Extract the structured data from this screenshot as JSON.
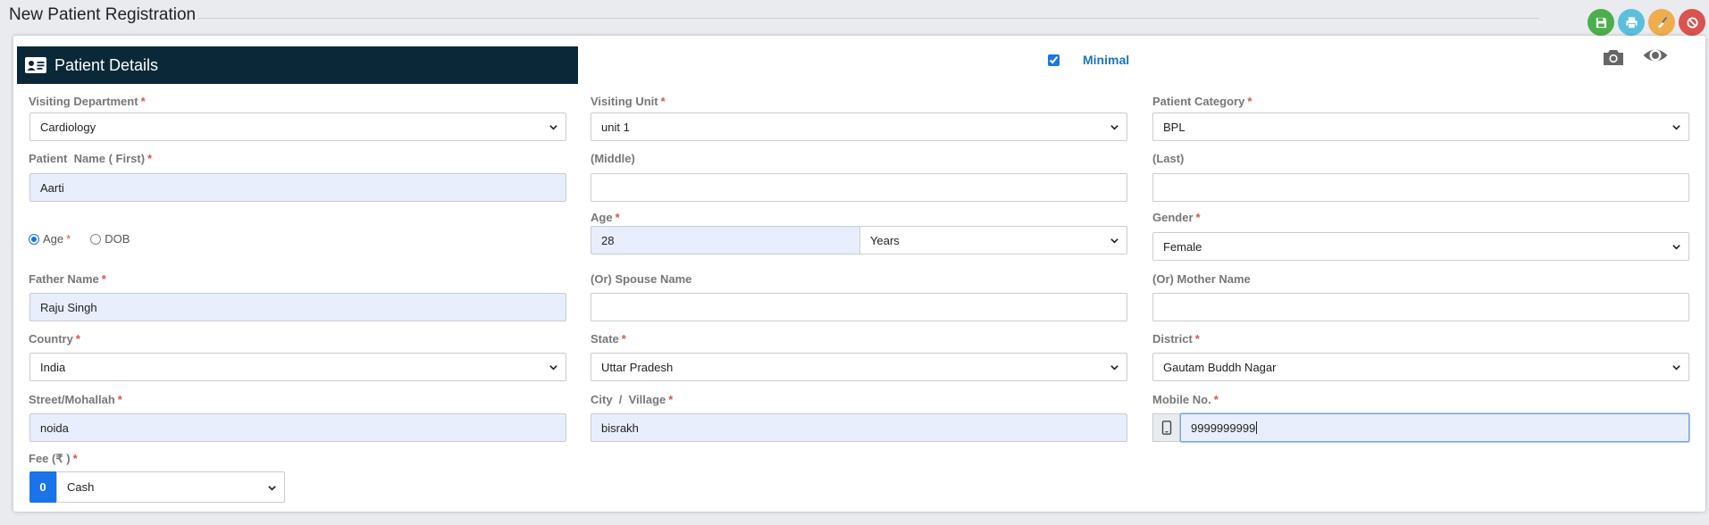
{
  "page": {
    "title": "New Patient Registration"
  },
  "toolbar": {
    "buttons": [
      {
        "name": "save",
        "icon": "save-icon",
        "color": "#4cae4c"
      },
      {
        "name": "print",
        "icon": "print-icon",
        "color": "#5bc0de"
      },
      {
        "name": "clear",
        "icon": "broom-icon",
        "color": "#f0ad4e"
      },
      {
        "name": "cancel",
        "icon": "ban-icon",
        "color": "#d9534f"
      }
    ]
  },
  "panel": {
    "title": "Patient Details",
    "minimal_label": "Minimal",
    "minimal_checked": true
  },
  "form": {
    "visiting_department": {
      "label": "Visiting Department",
      "value": "Cardiology"
    },
    "visiting_unit": {
      "label": "Visiting Unit",
      "value": "unit 1"
    },
    "patient_category": {
      "label": "Patient Category",
      "value": "BPL"
    },
    "first_name": {
      "label": "Patient  Name ( First)",
      "value": "Aarti"
    },
    "middle_name": {
      "label": "(Middle)",
      "value": ""
    },
    "last_name": {
      "label": "(Last)",
      "value": ""
    },
    "age_mode": {
      "age_label": "Age",
      "dob_label": "DOB",
      "selected": "age"
    },
    "age": {
      "label": "Age",
      "value": "28",
      "unit": "Years"
    },
    "gender": {
      "label": "Gender",
      "value": "Female"
    },
    "father_name": {
      "label": "Father Name",
      "value": "Raju Singh"
    },
    "spouse_name": {
      "label": "(Or) Spouse Name",
      "value": ""
    },
    "mother_name": {
      "label": "(Or) Mother Name",
      "value": ""
    },
    "country": {
      "label": "Country",
      "value": "India"
    },
    "state": {
      "label": "State",
      "value": "Uttar Pradesh"
    },
    "district": {
      "label": "District",
      "value": "Gautam Buddh Nagar"
    },
    "street": {
      "label": "Street/Mohallah",
      "value": "noida"
    },
    "city": {
      "label": "City  /  Village",
      "value": "bisrakh"
    },
    "mobile": {
      "label": "Mobile No.",
      "value": "9999999999"
    },
    "fee": {
      "label": "Fee (₹ )",
      "amount": "0",
      "mode": "Cash"
    }
  },
  "colors": {
    "header_bg": "#0b2838",
    "accent": "#1a73e8",
    "required": "#d9534f"
  }
}
